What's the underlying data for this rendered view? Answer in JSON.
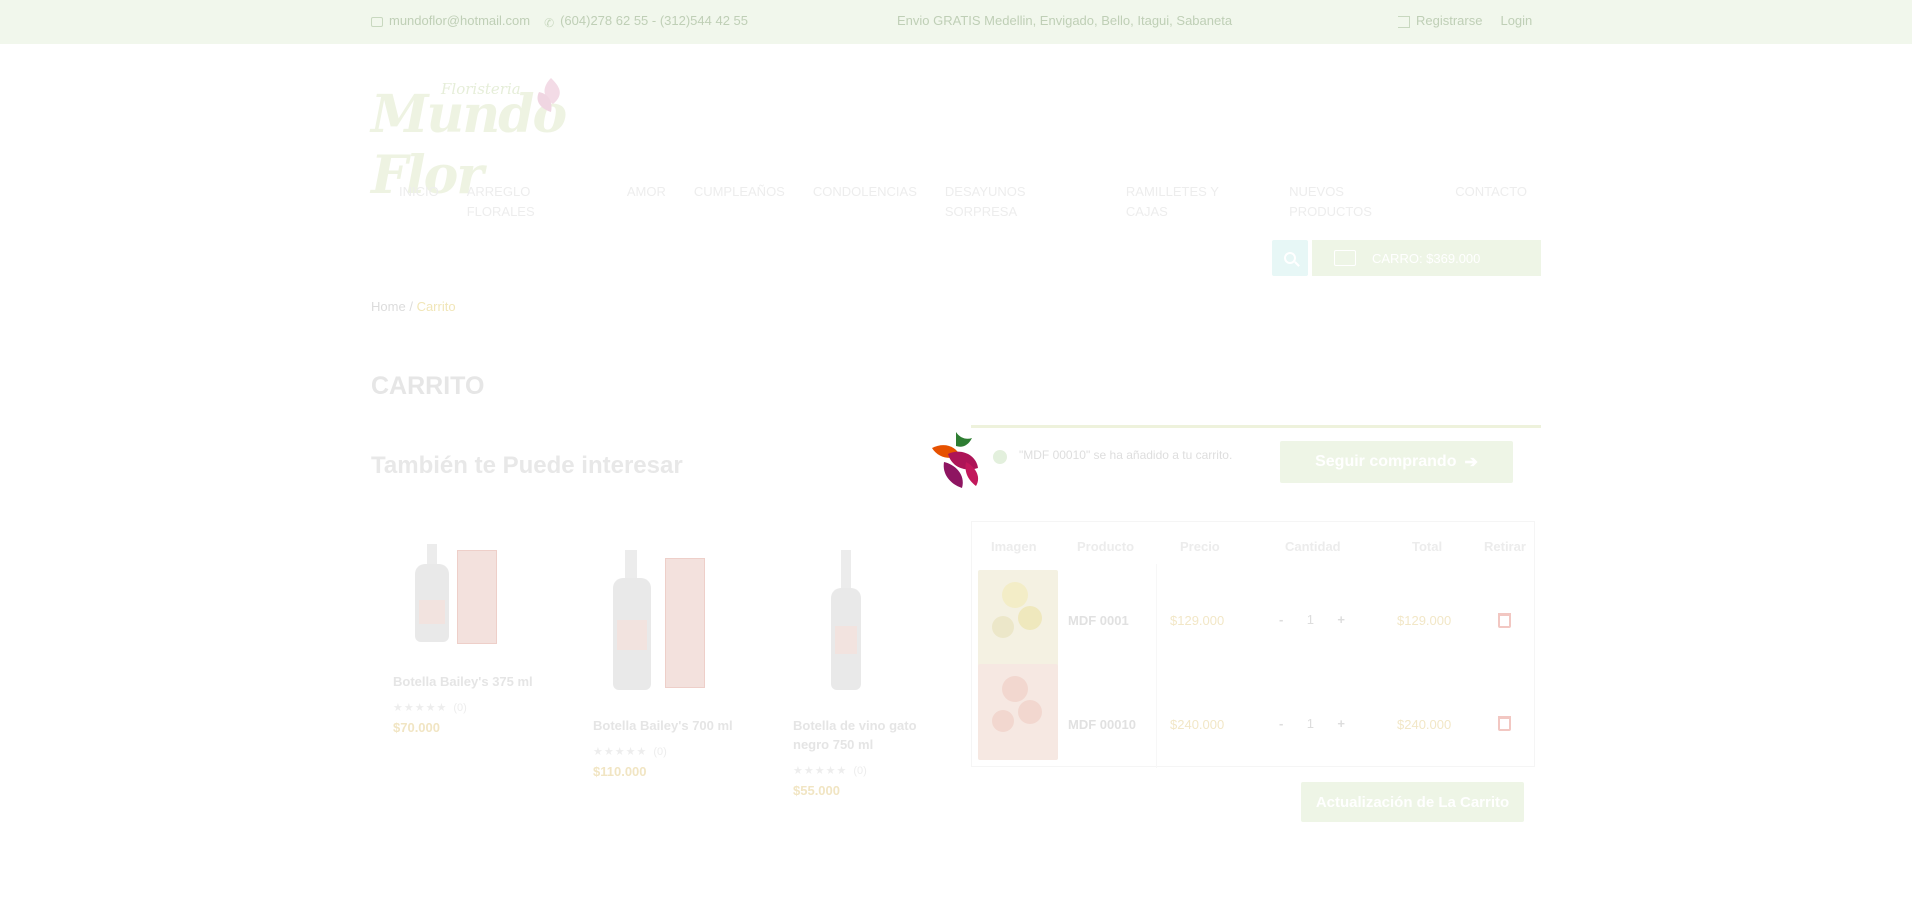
{
  "topbar": {
    "email": "mundoflor@hotmail.com",
    "phones": "(604)278 62 55 - (312)544 42 55",
    "shipping_notice": "Envio GRATIS Medellin, Envigado, Bello, Itagui, Sabaneta",
    "register": "Registrarse",
    "login": "Login"
  },
  "logo": {
    "small_text": "Floristeria",
    "main_text": "Mundo Flor"
  },
  "nav": {
    "items": [
      "INICIO",
      "ARREGLO FLORALES",
      "AMOR",
      "CUMPLEAÑOS",
      "CONDOLENCIAS",
      "DESAYUNOS SORPRESA",
      "RAMILLETES Y CAJAS",
      "NUEVOS PRODUCTOS",
      "CONTACTO"
    ]
  },
  "cart_button": {
    "label": "CARRO: $369.000"
  },
  "breadcrumb": {
    "home": "Home",
    "separator": "/",
    "current": "Carrito"
  },
  "page_title": "CARRITO",
  "recommendations": {
    "title": "También te Puede interesar",
    "products": [
      {
        "name": "Botella Bailey's 375 ml",
        "rating_count": "(0)",
        "price": "$70.000"
      },
      {
        "name": "Botella Bailey's 700 ml",
        "rating_count": "(0)",
        "price": "$110.000"
      },
      {
        "name": "Botella de vino gato negro 750 ml",
        "rating_count": "(0)",
        "price": "$55.000"
      }
    ],
    "stars": "★★★★★"
  },
  "notice": {
    "message": "\"MDF 00010\" se ha añadido a tu carrito.",
    "continue_label": "Seguir comprando"
  },
  "cart_table": {
    "headers": {
      "image": "Imagen",
      "product": "Producto",
      "price": "Precio",
      "quantity": "Cantidad",
      "total": "Total",
      "remove": "Retirar"
    },
    "rows": [
      {
        "sku": "MDF 0001",
        "price": "$129.000",
        "qty": "1",
        "total": "$129.000"
      },
      {
        "sku": "MDF 00010",
        "price": "$240.000",
        "qty": "1",
        "total": "$240.000"
      }
    ],
    "minus": "-",
    "plus": "+"
  },
  "update_label": "Actualización de La Carrito",
  "colors": {
    "accent_green": "#8cc63f",
    "price_gold": "#c9a227",
    "teal": "#26b6ad"
  }
}
